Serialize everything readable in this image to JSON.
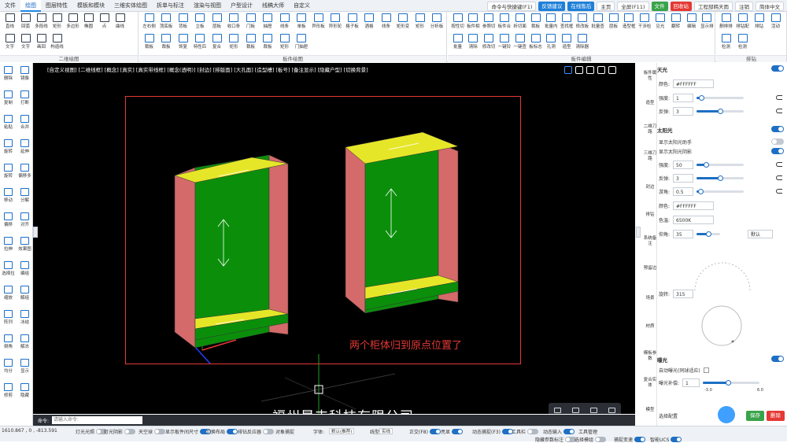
{
  "menubar": {
    "tabs": [
      "文件",
      "绘图",
      "图层特性",
      "模板和模块",
      "三维实体绘图",
      "拆单与标注",
      "渲染与视图",
      "户型设计",
      "线稿大师",
      "自定义"
    ],
    "active_tab": "绘图",
    "command_search": "命令与快捷键(F1)",
    "feedback": "反馈建议",
    "service": "在线售后",
    "home": "主页",
    "fullscreen": "全屏(F11)",
    "file": "文件",
    "recycle": "回收站",
    "user": "工程部韩天雨",
    "logout": "注销",
    "language": "简体中文"
  },
  "ribbon": {
    "groups": [
      {
        "title": "二维绘图",
        "buttons": [
          "直线",
          "回弧",
          "多段线",
          "矩形",
          "多边形",
          "椭圆",
          "点",
          "曲线",
          "文字",
          "文字",
          "画回",
          "构造线"
        ]
      },
      {
        "title": "板件绘图",
        "buttons": [
          "左右侧",
          "顶底板",
          "背板",
          "立板",
          "层板",
          "收口条",
          "门板",
          "抽屉",
          "线条",
          "单板",
          "异形板",
          "异形轮",
          "格子板",
          "酒格",
          "线条",
          "矩形变",
          "矩形",
          "分析板",
          "裁板",
          "裁板",
          "饰复",
          "特性匹",
          "复合",
          "矩形",
          "裁板",
          "裁板",
          "矩形",
          "门抽屉"
        ]
      },
      {
        "title": "板件编辑",
        "buttons": [
          "按性切",
          "板件相",
          "参照切",
          "板件合",
          "析切面",
          "裁板",
          "批量内",
          "查找框",
          "修改板",
          "批量查",
          "层板",
          "造型框",
          "干涉检",
          "见光",
          "翻转",
          "编辑",
          "显示排",
          "批量",
          "清除",
          "修改切",
          "一键铃",
          "一键查",
          "板标志",
          "孔洞",
          "造型",
          "清除器"
        ]
      },
      {
        "title": "排钻",
        "buttons": [
          "删排排",
          "排钻配",
          "排钻",
          "活动",
          "检测",
          "检测"
        ]
      }
    ]
  },
  "left_toolbar": [
    "删除",
    "镜像",
    "复制",
    "打断",
    "粘贴",
    "合并",
    "旋转",
    "延伸",
    "旋转",
    "偏移多",
    "移动",
    "分解",
    "偏移",
    "对齐",
    "拉伸",
    "效果图",
    "选择拉",
    "编组",
    "缩放",
    "解组",
    "阵列",
    "冰结",
    "倒角",
    "解冻",
    "均分",
    "显示",
    "修剪",
    "隐藏"
  ],
  "viewport": {
    "toolbar_items": [
      "[自定义视图]",
      "[二维线框]",
      "[概念]",
      "[真实]",
      "[真实带线框]",
      "[概念(透明)]",
      "[封边]",
      "[排版面]",
      "[大孔面]",
      "[造型槽]",
      "[板号]",
      "[备注显示]",
      "[隐藏户型]",
      "[切换背景]"
    ],
    "annotation": "两个柜体归到原点位置了",
    "company": "福州晨丰科技有限公司",
    "colors": {
      "top": "#e6e629",
      "side": "#d46a6a",
      "back": "#0b8f0b",
      "annot": "#e53935"
    }
  },
  "command": {
    "label": "命令:",
    "placeholder": "请输入命令:"
  },
  "status": {
    "coords": "1610.867 , 0 , -813.591",
    "items": [
      "灯光光照",
      "灯光阴影",
      "天空球",
      "显示板件间尺寸",
      "切换布局",
      "排钻反应器",
      "对象捕捉",
      "字体:",
      "默认(推荐)",
      "线型:",
      "实线",
      "正交(F8)",
      "亮显",
      "动态捕捉(F3)",
      "工具栏",
      "动态输入",
      "工具管理",
      "隐藏参数标注",
      "选择模组",
      "捕捉变速",
      "智能UCS"
    ]
  },
  "right_nav": [
    "板件属性",
    "造型",
    "二维刀路",
    "三维刀路",
    "封边",
    "排钻",
    "系统备注",
    "预留边",
    "场景",
    "材质",
    "模板参数",
    "复合实体",
    "模型"
  ],
  "props": {
    "sky_title": "天光",
    "sky_color_label": "颜色:",
    "sky_color": "#FFFFFF",
    "sky_intensity_label": "强度:",
    "sky_intensity": "1",
    "sky_reflect_label": "反弹:",
    "sky_reflect": "3",
    "sun_title": "太阳光",
    "sun_helper": "显示太阳光助手",
    "sun_shadow": "显示太阳光阴影",
    "sun_intensity_label": "强度:",
    "sun_intensity": "50",
    "sun_reflect_label": "反弹:",
    "sun_reflect": "3",
    "sun_blur_label": "游角:",
    "sun_blur": "0.5",
    "sun_color_label": "颜色:",
    "sun_color": "#FFFFFF",
    "sun_temp_label": "色温:",
    "sun_temp": "6500K",
    "sun_pitch_label": "仰角:",
    "sun_pitch": "35",
    "default_label": "默认",
    "rotate_label": "旋转:",
    "rotate": "315",
    "exposure_title": "曝光",
    "auto_exposure": "自动曝光(同球适应)",
    "exposure_comp_label": "曝光补偿:",
    "exposure_comp": "1",
    "exp_min": "-3.0",
    "exp_max": "6.0",
    "select_config": "选择配置",
    "save_button": "保存",
    "delete_button": "删除"
  }
}
